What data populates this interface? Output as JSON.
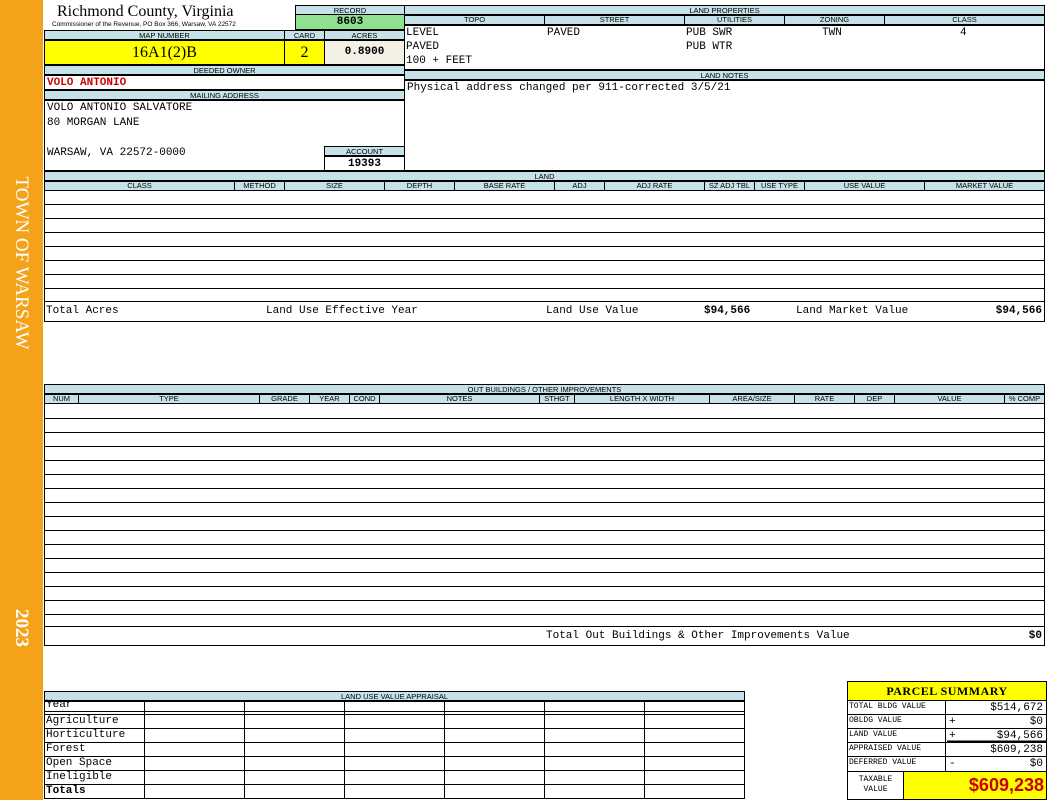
{
  "side_banner": {
    "town": "TOWN OF WARSAW",
    "year": "2023"
  },
  "header": {
    "county": "Richmond County, Virginia",
    "commissioner": "Commissioner of the Revenue, PO Box 366, Warsaw, VA 22572"
  },
  "record": {
    "label": "RECORD",
    "value": "8603"
  },
  "map_number": {
    "label": "MAP NUMBER",
    "value": "16A1(2)B"
  },
  "card": {
    "label": "CARD",
    "value": "2"
  },
  "acres": {
    "label": "ACRES",
    "value": "0.8900"
  },
  "deeded_owner": {
    "label": "DEEDED OWNER",
    "value": "VOLO ANTONIO"
  },
  "mailing": {
    "label": "MAILING ADDRESS",
    "line1": "VOLO ANTONIO SALVATORE",
    "line2": "80 MORGAN LANE",
    "line3": "WARSAW, VA 22572-0000"
  },
  "account": {
    "label": "ACCOUNT",
    "value": "19393"
  },
  "land_properties": {
    "label": "LAND PROPERTIES",
    "columns": [
      "TOPO",
      "STREET",
      "UTILITIES",
      "ZONING",
      "CLASS"
    ],
    "topo": [
      "LEVEL",
      "PAVED",
      "100 + FEET"
    ],
    "street": "PAVED",
    "utilities": [
      "PUB SWR",
      "PUB WTR"
    ],
    "zoning": "TWN",
    "class": "4"
  },
  "land_notes": {
    "label": "LAND NOTES",
    "text": "Physical address changed per 911-corrected 3/5/21"
  },
  "land": {
    "label": "LAND",
    "columns": [
      "CLASS",
      "METHOD",
      "SIZE",
      "DEPTH",
      "BASE RATE",
      "ADJ",
      "ADJ RATE",
      "SZ ADJ TBL",
      "USE TYPE",
      "USE VALUE",
      "MARKET VALUE"
    ],
    "total_acres_label": "Total Acres",
    "land_use_year_label": "Land Use Effective Year",
    "land_use_value_label": "Land Use Value",
    "land_use_value": "$94,566",
    "land_market_value_label": "Land Market Value",
    "land_market_value": "$94,566"
  },
  "outbuildings": {
    "label": "OUT BUILDINGS / OTHER IMPROVEMENTS",
    "columns": [
      "NUM",
      "TYPE",
      "GRADE",
      "YEAR",
      "COND",
      "NOTES",
      "STHGT",
      "LENGTH X WIDTH",
      "AREA/SIZE",
      "RATE",
      "DEP",
      "VALUE",
      "% COMP"
    ],
    "total_label": "Total Out Buildings & Other Improvements Value",
    "total_value": "$0"
  },
  "land_use_appraisal": {
    "label": "LAND USE VALUE APPRAISAL",
    "rows": [
      "Year",
      "Agriculture",
      "Horticulture",
      "Forest",
      "Open Space",
      "Ineligible",
      "Totals"
    ]
  },
  "parcel_summary": {
    "title": "PARCEL SUMMARY",
    "rows": [
      {
        "label": "TOTAL BLDG VALUE",
        "sign": "",
        "value": "$514,672"
      },
      {
        "label": "OBLDG VALUE",
        "sign": "+",
        "value": "$0"
      },
      {
        "label": "LAND VALUE",
        "sign": "+",
        "value": "$94,566"
      },
      {
        "label": "APPRAISED VALUE",
        "sign": "",
        "value": "$609,238"
      },
      {
        "label": "DEFERRED VALUE",
        "sign": "-",
        "value": "$0"
      }
    ],
    "taxable_label": "TAXABLE VALUE",
    "taxable_value": "$609,238"
  },
  "colors": {
    "banner": "#f5a21b",
    "header_fill": "#c6e2e8",
    "yellow": "#ffff00",
    "record_green": "#8fe08f",
    "owner_red": "#cc0000"
  }
}
